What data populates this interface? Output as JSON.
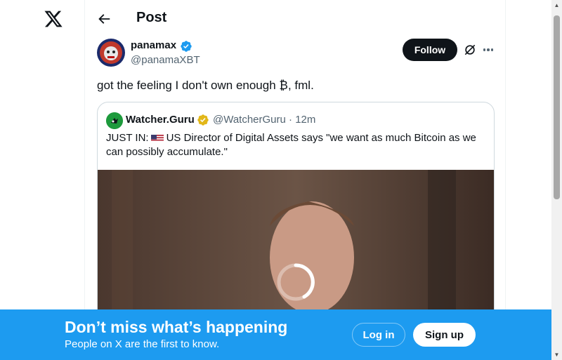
{
  "header": {
    "title": "Post"
  },
  "tweet": {
    "author_name": "panamax",
    "author_handle": "@panamaXBT",
    "follow_label": "Follow",
    "text": "got the feeling I don't own enough ₿, fml."
  },
  "quote": {
    "author_name": "Watcher.Guru",
    "meta": "@WatcherGuru · 12m",
    "text_prefix": "JUST IN:",
    "text_body": "US Director of Digital Assets says \"we want as much Bitcoin as we can possibly accumulate.\""
  },
  "banner": {
    "title": "Don’t miss what’s happening",
    "subtitle": "People on X are the first to know.",
    "login_label": "Log in",
    "signup_label": "Sign up"
  },
  "colors": {
    "accent": "#1d9bf0",
    "text": "#0f1419",
    "muted": "#536471",
    "gold_verified": "#e2b719"
  },
  "icons": [
    "x-logo-icon",
    "back-arrow-icon",
    "verified-badge-icon",
    "gold-verified-badge-icon",
    "grok-icon",
    "more-icon",
    "us-flag-icon",
    "loading-spinner-icon"
  ]
}
